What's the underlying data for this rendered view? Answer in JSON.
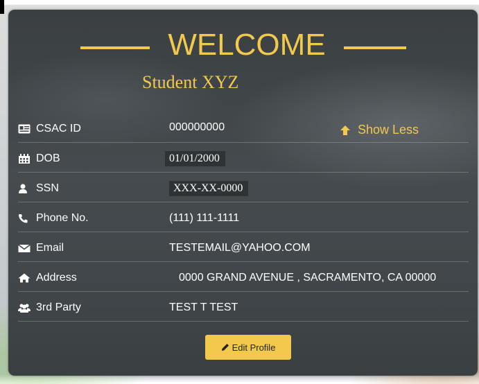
{
  "welcome": {
    "title": "WELCOME",
    "student_name": "Student XYZ"
  },
  "toggle": {
    "label": "Show Less"
  },
  "profile": {
    "rows": [
      {
        "label": "CSAC ID",
        "value": "000000000",
        "icon": "id-card-icon"
      },
      {
        "label": "DOB",
        "value": "01/01/2000",
        "icon": "calendar-icon"
      },
      {
        "label": "SSN",
        "value": "XXX-XX-0000",
        "icon": "user-icon"
      },
      {
        "label": "Phone No.",
        "value": "(111) 111-1111",
        "icon": "phone-icon"
      },
      {
        "label": "Email",
        "value": "TESTEMAIL@YAHOO.COM",
        "icon": "envelope-icon"
      },
      {
        "label": "Address",
        "value": "0000 GRAND AVENUE , SACRAMENTO, CA 00000",
        "icon": "home-icon"
      },
      {
        "label": "3rd Party",
        "value": "TEST T TEST",
        "icon": "users-icon"
      }
    ]
  },
  "actions": {
    "edit_profile_label": "Edit Profile"
  },
  "colors": {
    "accent": "#f2c94c",
    "card_background": "#3f4548",
    "text": "#ffffff"
  }
}
